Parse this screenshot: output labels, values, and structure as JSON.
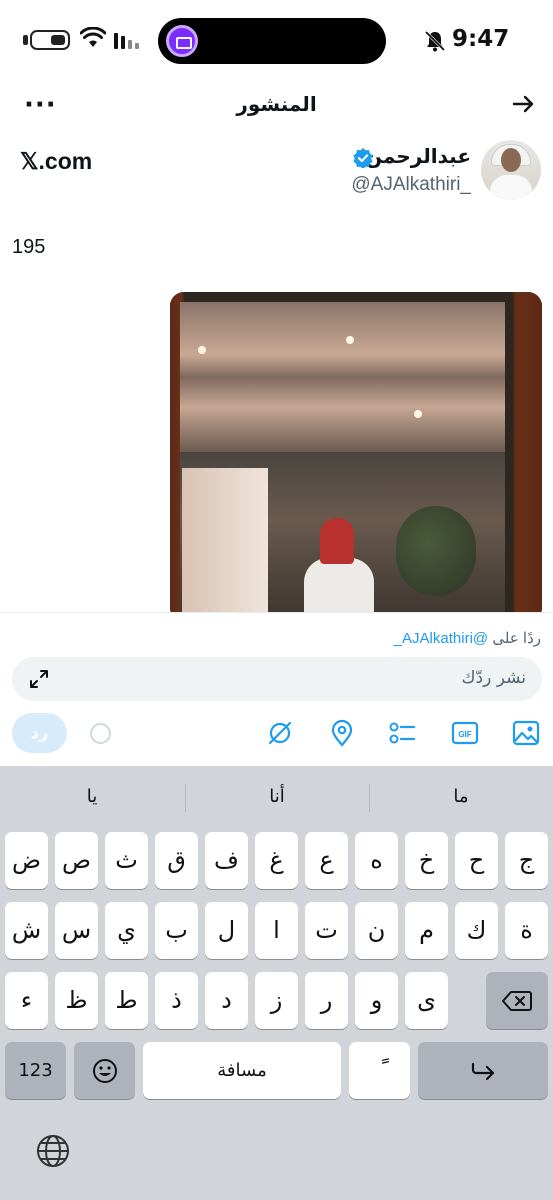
{
  "status_bar": {
    "time": "9:47"
  },
  "header": {
    "title": "المنشور"
  },
  "author": {
    "name": "عبدالرحمن",
    "handle": "@AJAlkathiri_",
    "site": "𝕏.com"
  },
  "post": {
    "text": "195"
  },
  "reply": {
    "reply_to_prefix": "ردًا على",
    "reply_to_handle": "@AJAlkathiri_",
    "placeholder": "نشر ردّك",
    "button_label": "رد"
  },
  "keyboard": {
    "suggestions": [
      "ما",
      "أنا",
      "يا"
    ],
    "row1": [
      "ج",
      "ح",
      "خ",
      "ه",
      "ع",
      "غ",
      "ف",
      "ق",
      "ث",
      "ص",
      "ض"
    ],
    "row2": [
      "ة",
      "ك",
      "م",
      "ن",
      "ت",
      "ا",
      "ل",
      "ب",
      "ي",
      "س",
      "ش"
    ],
    "row3": [
      "ى",
      "و",
      "ر",
      "ز",
      "د",
      "ذ",
      "ط",
      "ظ",
      "ء"
    ],
    "numbers_label": "123",
    "space_label": "مسافة",
    "tanween_label": "ً"
  },
  "colors": {
    "accent": "#1d9bf0",
    "reply_button_disabled": "#d7ebfa",
    "keyboard_bg": "#d1d4d9"
  }
}
